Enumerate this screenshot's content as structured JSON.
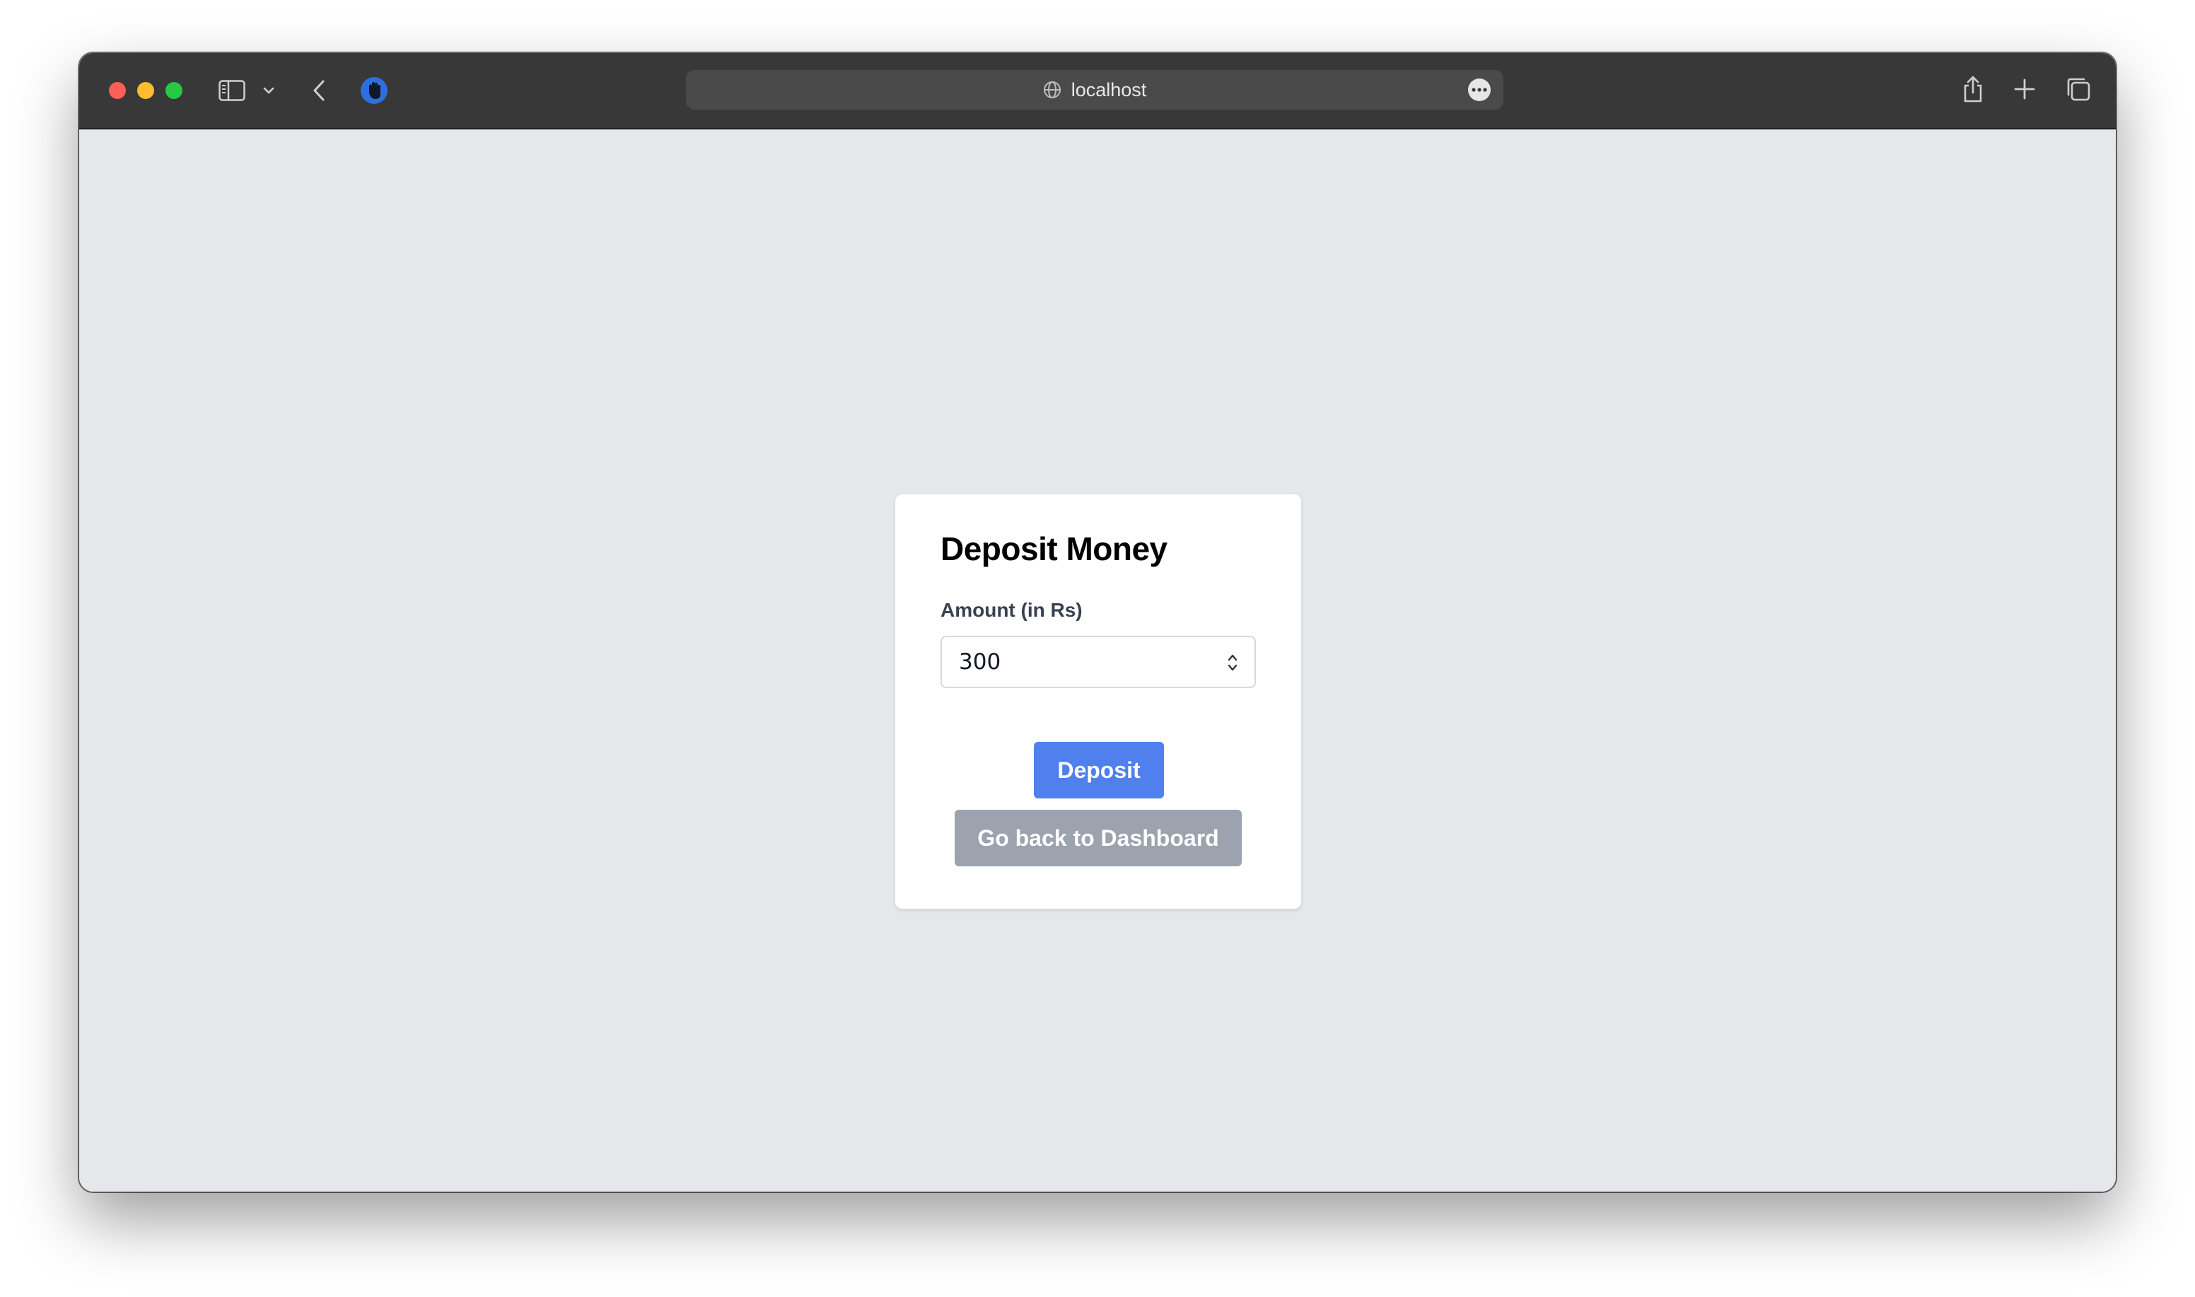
{
  "browser": {
    "url": "localhost"
  },
  "page": {
    "title": "Deposit Money",
    "amount_label": "Amount (in Rs)",
    "amount_value": "300",
    "deposit_button": "Deposit",
    "back_button": "Go back to Dashboard"
  },
  "colors": {
    "page_background": "#e5e7eb",
    "deposit_button": "#4f80ee",
    "back_button": "#9ca3af",
    "toolbar": "#383838"
  },
  "icons": {
    "toolbar": [
      "sidebar-icon",
      "chevron-down-icon",
      "back-arrow-icon",
      "extension-hand-icon",
      "share-icon",
      "new-tab-icon",
      "tabs-overview-icon"
    ],
    "address_bar": [
      "globe-icon",
      "more-icon"
    ],
    "input": [
      "stepper-icon"
    ]
  }
}
